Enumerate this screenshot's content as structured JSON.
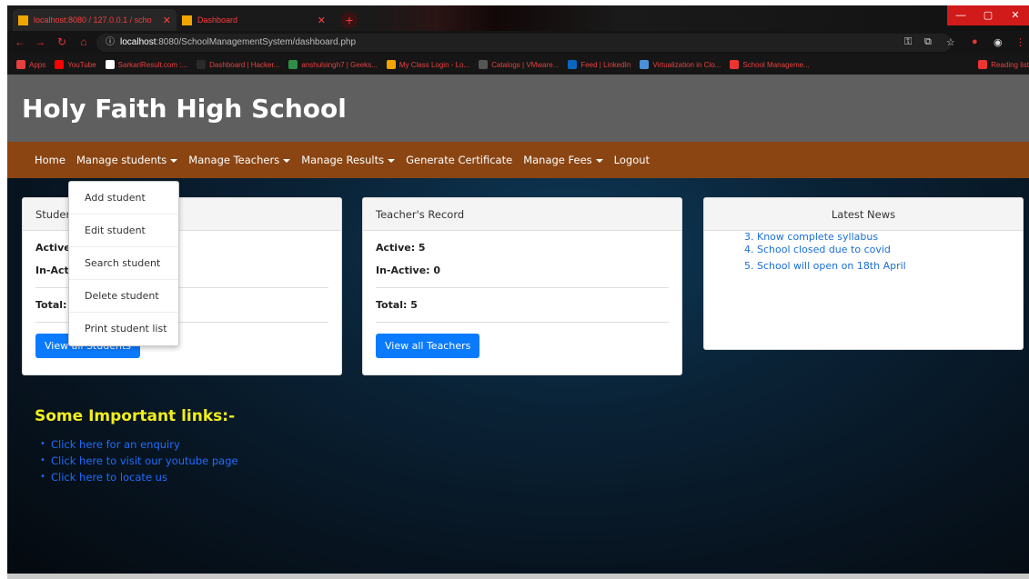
{
  "browser": {
    "tabs": [
      {
        "label": "localhost:8080 / 127.0.0.1 / scho",
        "active": true
      },
      {
        "label": "Dashboard",
        "active": false
      }
    ],
    "url_host": "localhost",
    "url_path": ":8080/SchoolManagementSystem/dashboard.php",
    "bookmarks": [
      {
        "label": "Apps",
        "icon": "apps-icon",
        "color": "#e84040"
      },
      {
        "label": "YouTube",
        "icon": "youtube-icon",
        "color": "#ff0000"
      },
      {
        "label": "SarkariResult.com :...",
        "icon": "sarkari-icon",
        "color": "#ffffff"
      },
      {
        "label": "Dashboard | Hacker...",
        "icon": "hacker-icon",
        "color": "#2a2a2a"
      },
      {
        "label": "anshulsingh7 | Geeks...",
        "icon": "geeks-icon",
        "color": "#2f8d46"
      },
      {
        "label": "My Class Login - Lo...",
        "icon": "myclass-icon",
        "color": "#f0a500"
      },
      {
        "label": "Catalogs | VMware...",
        "icon": "vmware-icon",
        "color": "#555"
      },
      {
        "label": "Feed | LinkedIn",
        "icon": "linkedin-icon",
        "color": "#0a66c2"
      },
      {
        "label": "Virtualization in Clo...",
        "icon": "virtual-icon",
        "color": "#4a90d9"
      },
      {
        "label": "School Manageme...",
        "icon": "lp-icon",
        "color": "#e33"
      },
      {
        "label": "Reading list",
        "icon": "reading-list-icon",
        "color": "#e33"
      }
    ]
  },
  "header": {
    "title": "Holy Faith High School"
  },
  "nav": {
    "home": "Home",
    "manage_students": "Manage students",
    "manage_teachers": "Manage Teachers",
    "manage_results": "Manage Results",
    "generate_certificate": "Generate Certificate",
    "manage_fees": "Manage Fees",
    "logout": "Logout"
  },
  "dropdown": {
    "items": [
      "Add student",
      "Edit student",
      "Search student",
      "Delete student",
      "Print student list"
    ]
  },
  "student_card": {
    "title": "Studen",
    "active_label": "Active:",
    "inactive_label": "In-Acti",
    "total_label": "Total: 5",
    "button": "View all Students"
  },
  "teacher_card": {
    "title": "Teacher's Record",
    "active_label": "Active: 5",
    "inactive_label": "In-Active: 0",
    "total_label": "Total: 5",
    "button": "View all Teachers"
  },
  "news_card": {
    "title": "Latest News",
    "items": [
      "3. Know complete syllabus",
      "4. School closed due to covid",
      "5. School will open on 18th April"
    ]
  },
  "links": {
    "heading": "Some Important links:-",
    "items": [
      "Click here for an enquiry",
      "Click here to visit our youtube page",
      "Click here to locate us"
    ]
  }
}
